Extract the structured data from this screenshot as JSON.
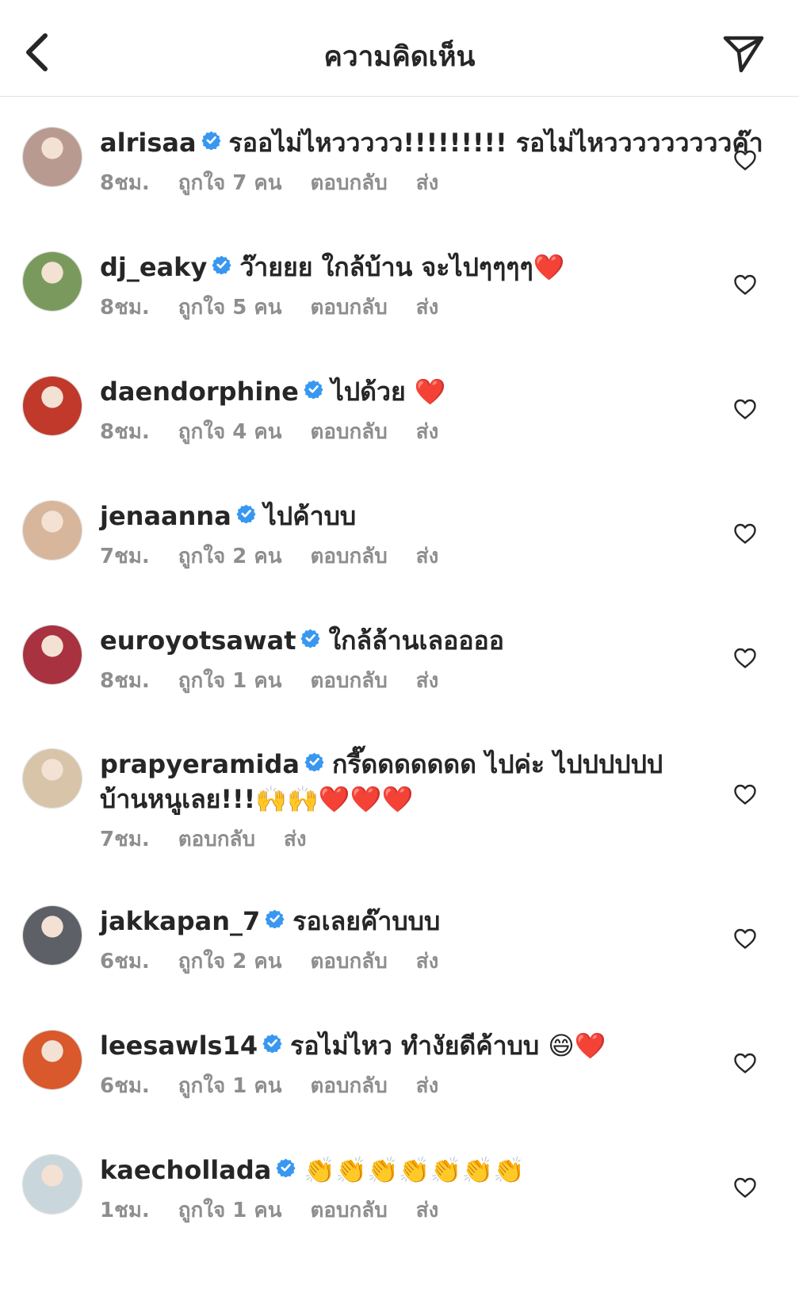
{
  "header": {
    "title": "ความคิดเห็น",
    "back_icon": "chevron-left-icon",
    "share_icon": "paper-plane-icon"
  },
  "comments": [
    {
      "username": "alrisaa",
      "text": "รออไม่ไหววววว!!!!!!!!! รอไม่ไหวววววววววค๊า",
      "time": "8ชม.",
      "likes": "ถูกใจ 7 คน",
      "reply": "ตอบกลับ",
      "send": "ส่ง",
      "avatar_color": "#b99a90"
    },
    {
      "username": "dj_eaky",
      "text": "ว๊ายยย ใกล้บ้าน จะไปๆๆๆๆ❤️",
      "time": "8ชม.",
      "likes": "ถูกใจ 5 คน",
      "reply": "ตอบกลับ",
      "send": "ส่ง",
      "avatar_color": "#7a9a5d"
    },
    {
      "username": "daendorphine",
      "text": "ไปด้วย ❤️",
      "time": "8ชม.",
      "likes": "ถูกใจ 4 คน",
      "reply": "ตอบกลับ",
      "send": "ส่ง",
      "avatar_color": "#c0392b"
    },
    {
      "username": "jenaanna",
      "text": "ไปค้าบบ",
      "time": "7ชม.",
      "likes": "ถูกใจ 2 คน",
      "reply": "ตอบกลับ",
      "send": "ส่ง",
      "avatar_color": "#d7b69c"
    },
    {
      "username": "euroyotsawat",
      "text": "ใกล้ล้านเลออออ",
      "time": "8ชม.",
      "likes": "ถูกใจ 1 คน",
      "reply": "ตอบกลับ",
      "send": "ส่ง",
      "avatar_color": "#a83240"
    },
    {
      "username": "prapyeramida",
      "text": "กรี๊ดดดดดดด ไปค่ะ ไปปปปปป บ้านหนูเลย!!!🙌🙌❤️❤️❤️",
      "time": "7ชม.",
      "reply": "ตอบกลับ",
      "send": "ส่ง",
      "avatar_color": "#d8c4a8"
    },
    {
      "username": "jakkapan_7",
      "text": "รอเลยค๊าบบบ",
      "time": "6ชม.",
      "likes": "ถูกใจ 2 คน",
      "reply": "ตอบกลับ",
      "send": "ส่ง",
      "avatar_color": "#5d6066"
    },
    {
      "username": "leesawls14",
      "text": "รอไม่ไหว ทำงัยดีค้าบบ 😄❤️",
      "time": "6ชม.",
      "likes": "ถูกใจ 1 คน",
      "reply": "ตอบกลับ",
      "send": "ส่ง",
      "avatar_color": "#d9582c"
    },
    {
      "username": "kaechollada",
      "text": "👏👏👏👏👏👏👏",
      "time": "1ชม.",
      "likes": "ถูกใจ 1 คน",
      "reply": "ตอบกลับ",
      "send": "ส่ง",
      "avatar_color": "#c9d6dc"
    }
  ],
  "colors": {
    "verified": "#3897f0",
    "meta_text": "#8e8e8e",
    "primary_text": "#262626"
  },
  "icons": {
    "verified": "verified-badge-icon",
    "like": "heart-outline-icon"
  }
}
